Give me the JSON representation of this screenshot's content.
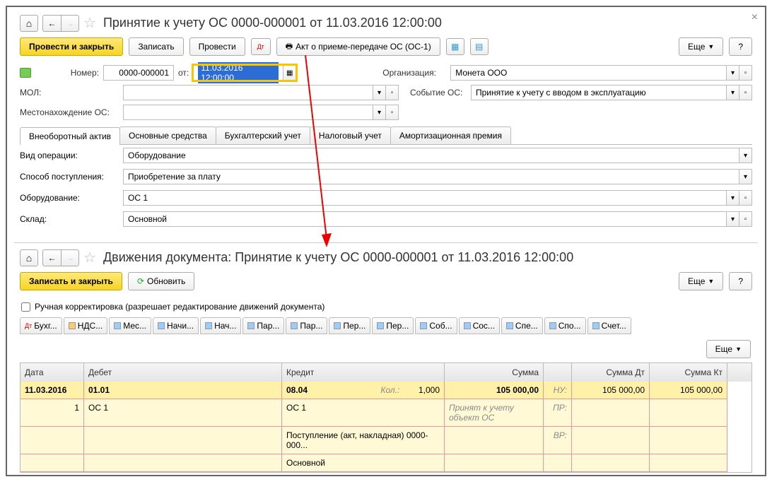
{
  "top": {
    "title": "Принятие к учету ОС 0000-000001 от 11.03.2016 12:00:00",
    "buttons": {
      "post_close": "Провести и закрыть",
      "save": "Записать",
      "post": "Провести",
      "print_act": "Акт о приеме-передаче ОС (ОС-1)",
      "more": "Еще",
      "help": "?"
    },
    "fields": {
      "number_label": "Номер:",
      "number_value": "0000-000001",
      "from_label": "от:",
      "date_value": "11.03.2016 12:00:00",
      "org_label": "Организация:",
      "org_value": "Монета ООО",
      "mol_label": "МОЛ:",
      "event_label": "Событие ОС:",
      "event_value": "Принятие к учету с вводом в эксплуатацию",
      "location_label": "Местонахождение ОС:"
    },
    "tabs": [
      "Внеоборотный актив",
      "Основные средства",
      "Бухгалтерский учет",
      "Налоговый учет",
      "Амортизационная премия"
    ],
    "detail": {
      "op_label": "Вид операции:",
      "op_value": "Оборудование",
      "method_label": "Способ поступления:",
      "method_value": "Приобретение за плату",
      "equip_label": "Оборудование:",
      "equip_value": "ОС 1",
      "stock_label": "Склад:",
      "stock_value": "Основной"
    }
  },
  "bottom": {
    "title": "Движения документа: Принятие к учету ОС 0000-000001 от 11.03.2016 12:00:00",
    "buttons": {
      "save_close": "Записать и закрыть",
      "refresh": "Обновить",
      "more": "Еще",
      "help": "?"
    },
    "manual_label": "Ручная корректировка (разрешает редактирование движений документа)",
    "move_tabs": [
      "Бухг...",
      "НДС...",
      "Мес...",
      "Начи...",
      "Нач...",
      "Пар...",
      "Пар...",
      "Пер...",
      "Пер...",
      "Соб...",
      "Сос...",
      "Спе...",
      "Спо...",
      "Счет..."
    ],
    "grid": {
      "headers": {
        "date": "Дата",
        "debit": "Дебет",
        "credit": "Кредит",
        "sum": "Сумма",
        "sumdt": "Сумма Дт",
        "sumkt": "Сумма Кт"
      },
      "row1": {
        "date": "11.03.2016",
        "debit": "01.01",
        "credit": "08.04",
        "kol_label": "Кол.:",
        "kol": "1,000",
        "sum": "105 000,00",
        "nu": "НУ:",
        "sumdt": "105 000,00",
        "sumkt": "105 000,00"
      },
      "row2": {
        "num": "1",
        "debit": "ОС 1",
        "credit": "ОС 1",
        "desc": "Принят к учету объект ОС",
        "pr": "ПР:"
      },
      "row3": {
        "credit": "Поступление (акт, накладная) 0000-000...",
        "vr": "ВР:"
      },
      "row4": {
        "credit": "Основной"
      }
    }
  }
}
